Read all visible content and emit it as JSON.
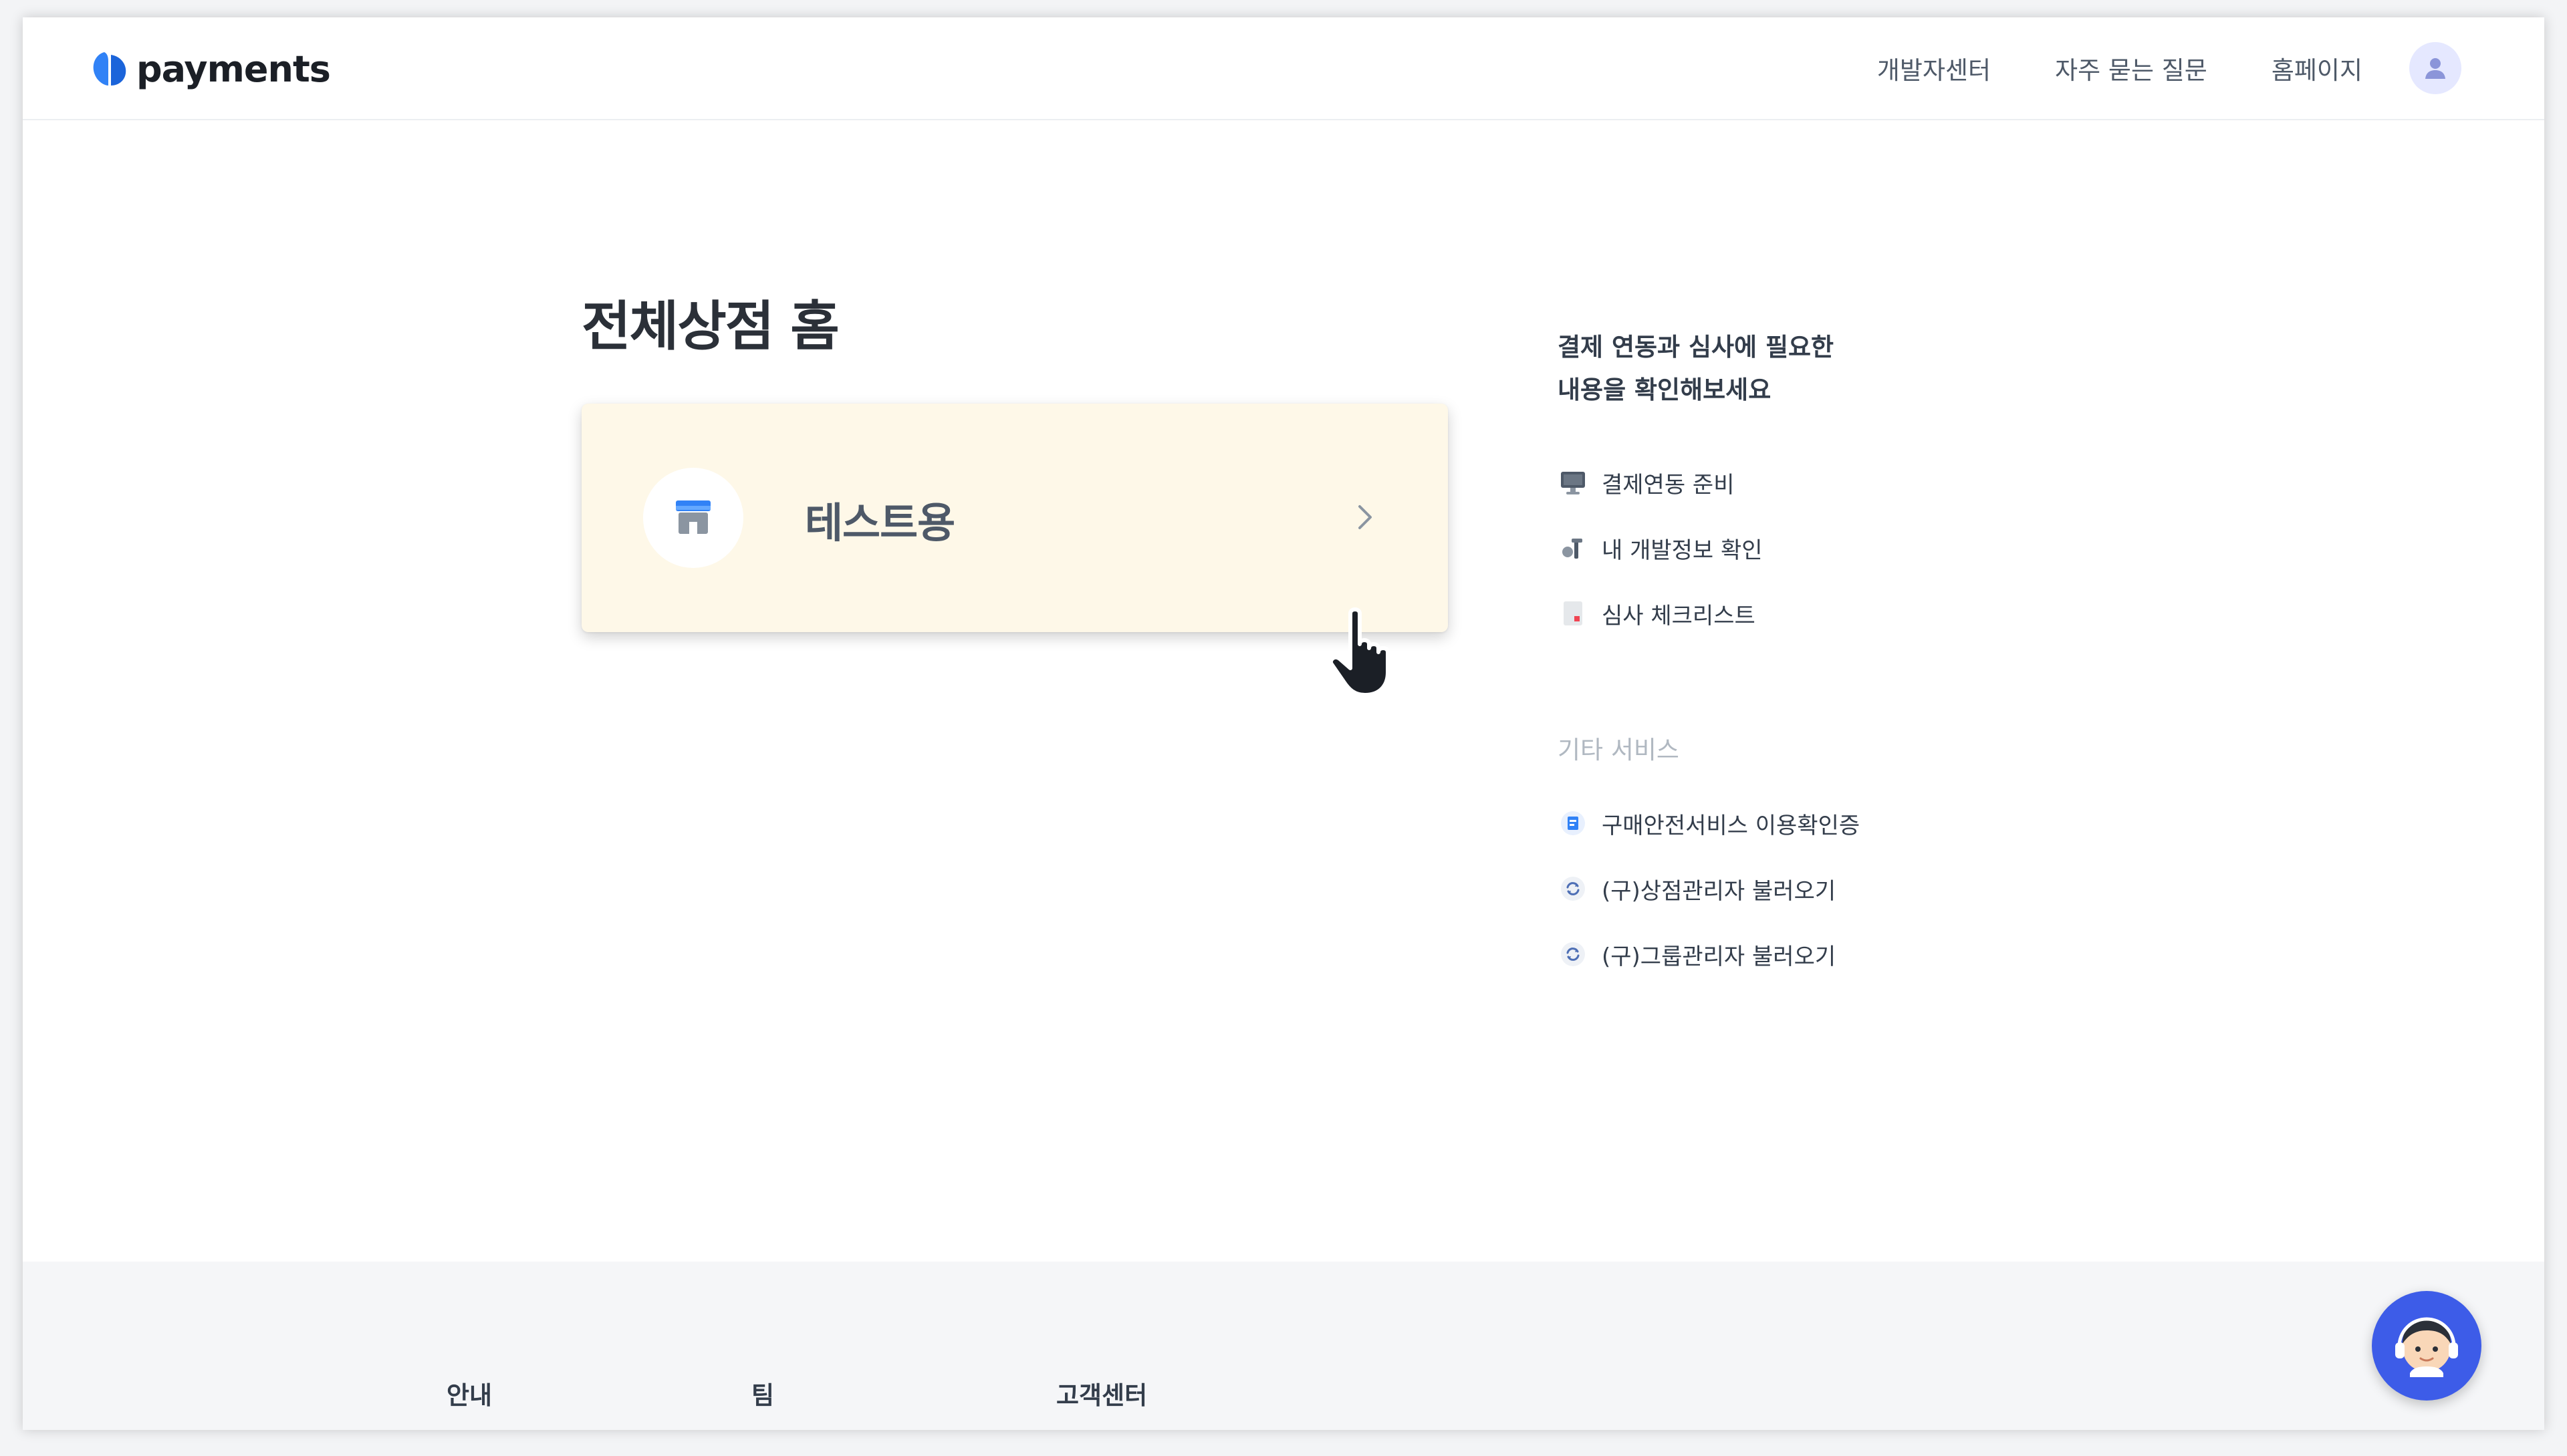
{
  "header": {
    "logo_text": "payments",
    "nav": [
      "개발자센터",
      "자주 묻는 질문",
      "홈페이지"
    ]
  },
  "main": {
    "title": "전체상점 홈",
    "store": {
      "name": "테스트용"
    }
  },
  "sidebar": {
    "heading_line1": "결제 연동과 심사에 필요한",
    "heading_line2": "내용을 확인해보세요",
    "guide_items": [
      {
        "label": "결제연동 준비",
        "icon": "monitor-icon"
      },
      {
        "label": "내 개발정보 확인",
        "icon": "tools-icon"
      },
      {
        "label": "심사 체크리스트",
        "icon": "checklist-icon"
      }
    ],
    "other_title": "기타 서비스",
    "other_items": [
      {
        "label": "구매안전서비스 이용확인증",
        "icon": "certificate-icon"
      },
      {
        "label": "(구)상점관리자 불러오기",
        "icon": "refresh-icon"
      },
      {
        "label": "(구)그룹관리자 불러오기",
        "icon": "refresh-icon"
      }
    ]
  },
  "footer": {
    "columns": [
      "안내",
      "팀",
      "고객센터"
    ]
  },
  "colors": {
    "brand": "#3182f6",
    "card_bg": "#fef8e8",
    "chat_button": "#3d5ce8"
  }
}
